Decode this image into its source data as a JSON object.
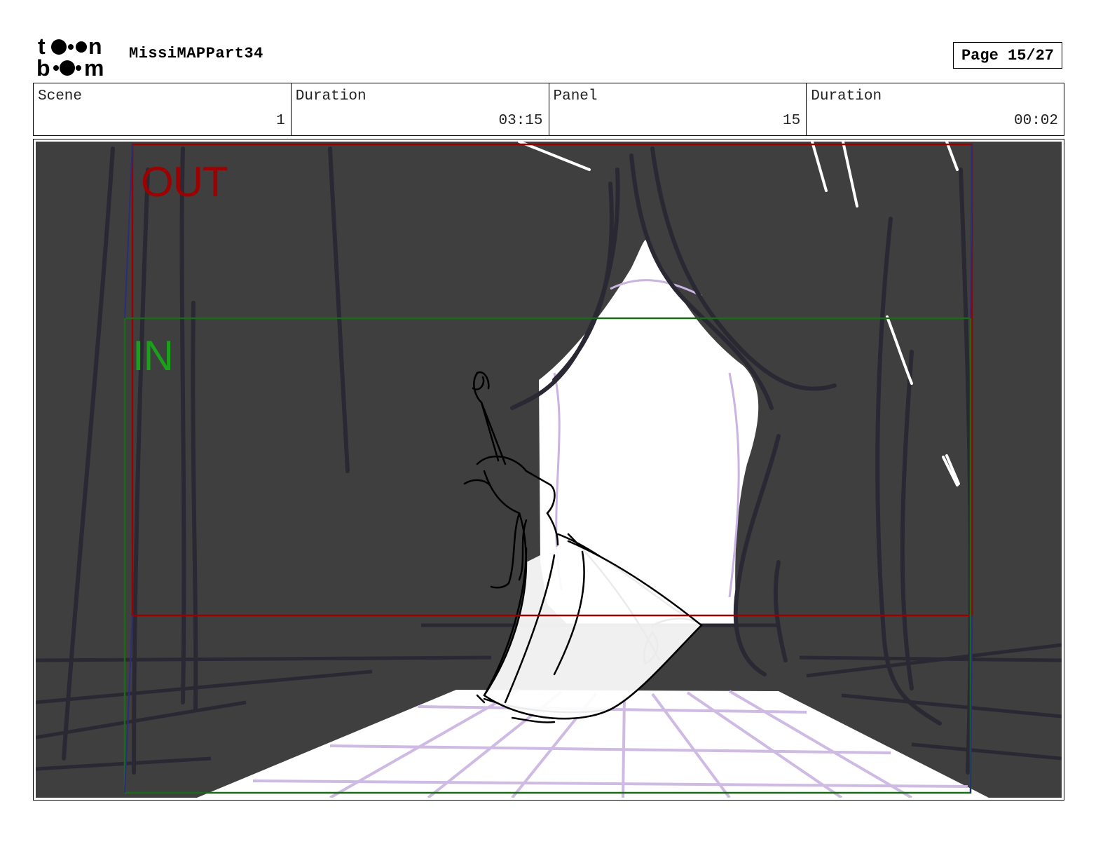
{
  "header": {
    "logo_text_top": "toon",
    "logo_text_bottom": "boom",
    "project_title": "MissiMAPPart34",
    "page_label": "Page 15/27"
  },
  "info": {
    "scene": {
      "label": "Scene",
      "value": "1"
    },
    "scene_duration": {
      "label": "Duration",
      "value": "03:15"
    },
    "panel": {
      "label": "Panel",
      "value": "15"
    },
    "panel_duration": {
      "label": "Duration",
      "value": "00:02"
    }
  },
  "panel": {
    "camera_out_label": "OUT",
    "camera_in_label": "IN",
    "colors": {
      "background": "#3f3f3f",
      "curtain_lines": "#2a2833",
      "stage_grid": "#c9b3e0",
      "out_frame": "#9c0000",
      "in_frame": "#1a6a1a",
      "sketch": "#000000"
    }
  }
}
